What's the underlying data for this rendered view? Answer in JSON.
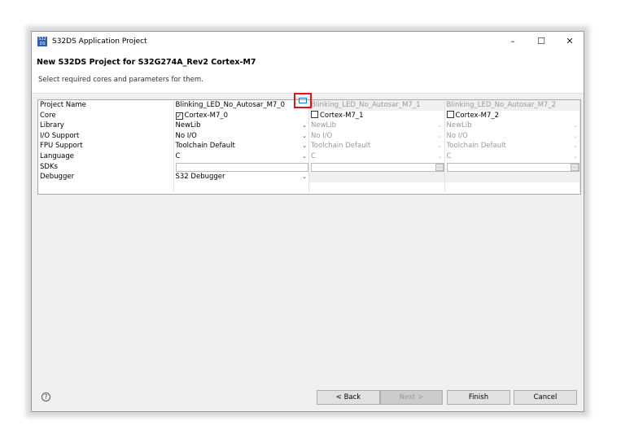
{
  "window": {
    "title": "S32DS Application Project",
    "icon": "s32ds-app-icon",
    "controls": [
      "minimize",
      "maximize",
      "close"
    ]
  },
  "header": {
    "title": "New S32DS Project for S32G274A_Rev2 Cortex-M7",
    "subtitle": "Select required cores and parameters for them."
  },
  "table": {
    "labels": [
      "Project Name",
      "Core",
      "Library",
      "I/O Support",
      "FPU Support",
      "Language",
      "SDKs",
      "Debugger"
    ],
    "columns": [
      {
        "project_name": "Blinking_LED_No_Autosar_M7_0",
        "core": "Cortex-M7_0",
        "core_checked": true,
        "library": "NewLib",
        "io": "No I/O",
        "fpu": "Toolchain Default",
        "language": "C",
        "sdks": "",
        "debugger": "S32 Debugger"
      },
      {
        "project_name": "Blinking_LED_No_Autosar_M7_1",
        "core": "Cortex-M7_1",
        "core_checked": false,
        "library": "NewLib",
        "io": "No I/O",
        "fpu": "Toolchain Default",
        "language": "C",
        "sdks": ""
      },
      {
        "project_name": "Blinking_LED_No_Autosar_M7_2",
        "core": "Cortex-M7_2",
        "core_checked": false,
        "library": "NewLib",
        "io": "No I/O",
        "fpu": "Toolchain Default",
        "language": "C",
        "sdks": ""
      }
    ],
    "browse_label": "..."
  },
  "footer": {
    "help": "?",
    "back": "< Back",
    "next": "Next >",
    "finish": "Finish",
    "cancel": "Cancel"
  },
  "colors": {
    "highlight": "#e0141e"
  }
}
